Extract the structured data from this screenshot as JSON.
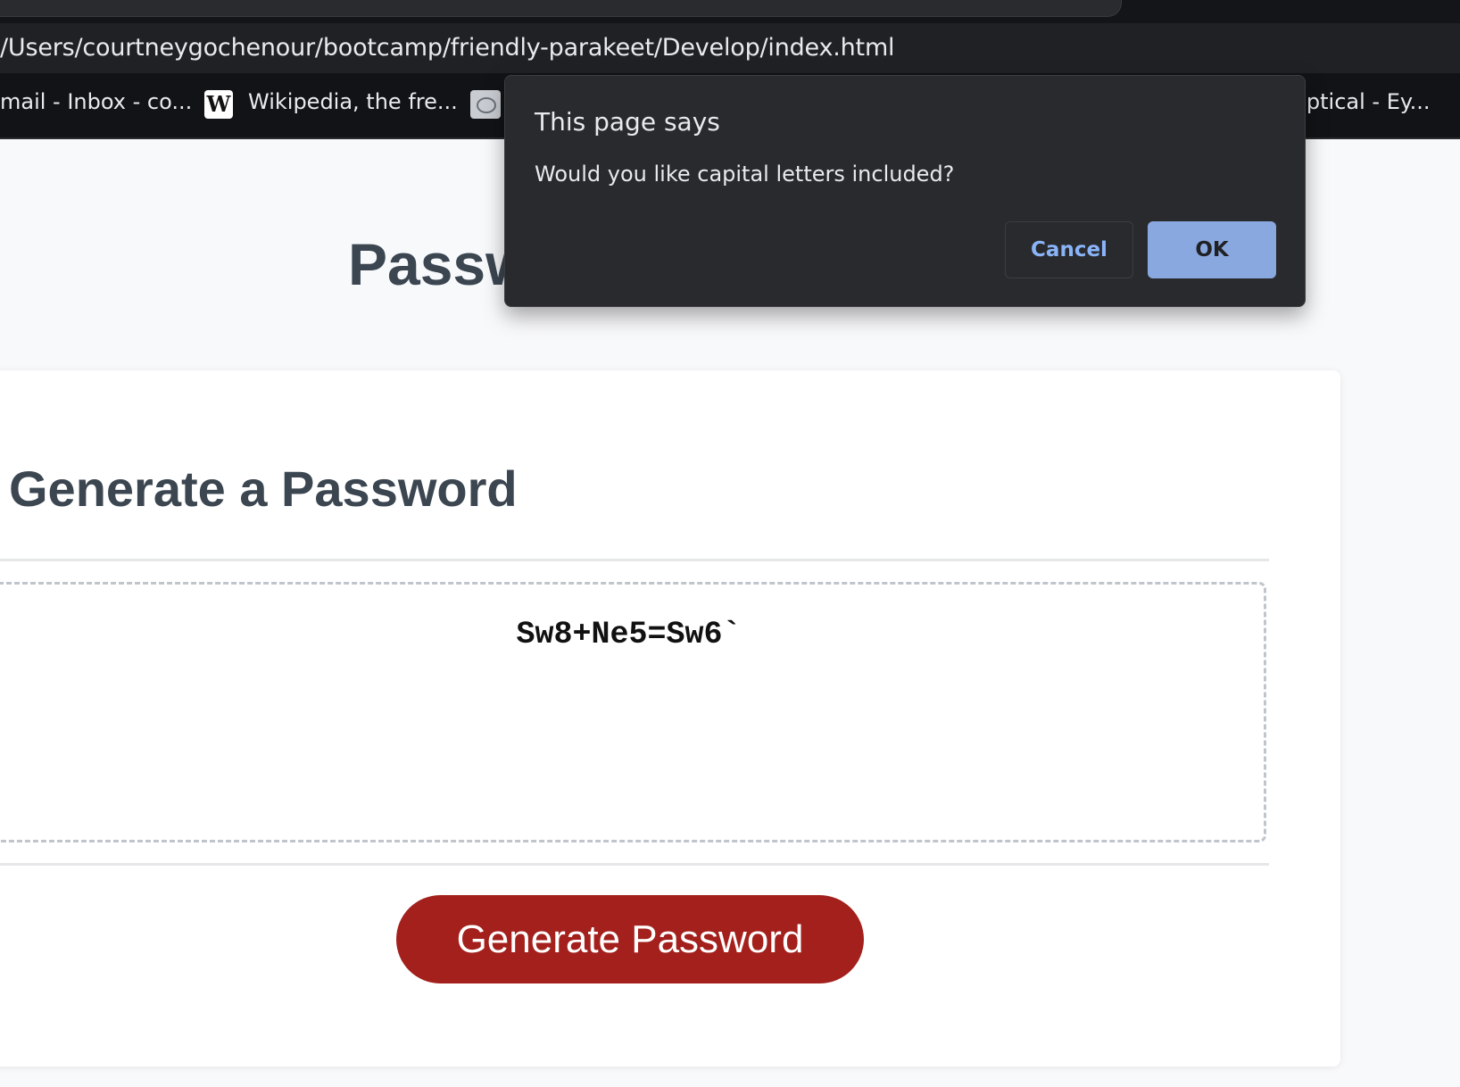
{
  "browser": {
    "url": "/Users/courtneygochenour/bootcamp/friendly-parakeet/Develop/index.html",
    "bookmarks": [
      {
        "label": "mail - Inbox - co...",
        "icon": "mail-icon"
      },
      {
        "label": "Wikipedia, the fre...",
        "icon": "wikipedia-icon",
        "icon_glyph": "W"
      },
      {
        "label": "",
        "icon": "globe-icon"
      },
      {
        "label": "Optical - Ey...",
        "icon": ""
      }
    ]
  },
  "page": {
    "title": "Passw",
    "card": {
      "header": "Generate a Password",
      "password_value": "Sw8+Ne5=Sw6`",
      "generate_label": "Generate Password"
    }
  },
  "dialog": {
    "title": "This page says",
    "message": "Would you like capital letters included?",
    "cancel_label": "Cancel",
    "ok_label": "OK"
  },
  "colors": {
    "generate_button": "#a3201c",
    "ok_button": "#8aa8e0",
    "cancel_text": "#8ab4f8",
    "dialog_bg": "#292a2d",
    "heading_text": "#3b4651"
  }
}
